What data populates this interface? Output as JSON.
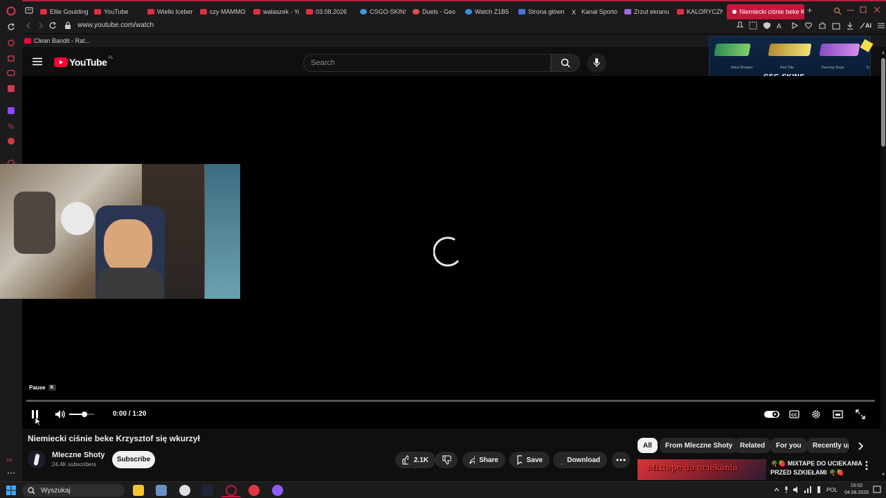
{
  "browser": {
    "tabs": [
      {
        "label": "Ellie Goulding",
        "color": "#e0303f"
      },
      {
        "label": "YouTube",
        "color": "#e0303f"
      },
      {
        "label": "Wielki Iceberg",
        "color": "#e0303f"
      },
      {
        "label": "czy MAMMO",
        "color": "#e0303f"
      },
      {
        "label": "walaszek - Yo",
        "color": "#e0303f"
      },
      {
        "label": "03.08.2026",
        "color": "#e0303f"
      },
      {
        "label": "CSGO-SKINS",
        "color": "#3a9ad9"
      },
      {
        "label": "Duels - Geo",
        "color": "#e05050"
      },
      {
        "label": "Watch Z1B5",
        "color": "#3a8ee0"
      },
      {
        "label": "Strona główn",
        "color": "#4a74e0"
      },
      {
        "label": "Kanał Sporto",
        "color": "#dddddd"
      },
      {
        "label": "Zrzut ekranu",
        "color": "#9a6be0"
      },
      {
        "label": "KALORYCZN",
        "color": "#e0303f"
      },
      {
        "label": "Niemiecki ciśnie beke K",
        "color": "#ffffff"
      }
    ],
    "new_tab": "+",
    "url": "www.youtube.com/watch",
    "bookmark": "Clean Bandit - Rat...",
    "ai_label": "AI"
  },
  "youtube": {
    "logo_text": "YouTube",
    "logo_region": "PL",
    "search_placeholder": "Search"
  },
  "ad": {
    "brand": "CSG SKINS",
    "items": [
      "Wave Breaker",
      "Red Tide",
      "Dancing Siege",
      "Ty"
    ]
  },
  "player": {
    "tooltip_label": "Pause",
    "tooltip_key": "K",
    "time_current": "0:00",
    "time_separator": "/",
    "time_total": "1:20",
    "progress": 0,
    "volume": 0.6
  },
  "video": {
    "title": "Niemiecki ciśnie beke Krzysztof się wkurzył",
    "channel_name": "Mleczne Shoty",
    "subscribers": "24.4K subscribers",
    "subscribe_label": "Subscribe",
    "likes": "2.1K",
    "share_label": "Share",
    "save_label": "Save",
    "download_label": "Download"
  },
  "sidebar_chips": [
    "All",
    "From Mleczne Shoty",
    "Related",
    "For you",
    "Recently up"
  ],
  "recommendation": {
    "title_line1": "🌴🍓 MIXTAPE DO UCIEKANIA",
    "title_line2": "PRZED SZKIEŁAMI 🌴🍓",
    "thumb_text": "Mixtape do uciekania"
  },
  "taskbar": {
    "search_placeholder": "Wyszukaj",
    "lang": "POL",
    "time": "16:02",
    "date": "04.08.2026"
  },
  "colors": {
    "opera_red": "#c3163c",
    "youtube_red": "#ff0033",
    "background": "#0f0f0f"
  }
}
